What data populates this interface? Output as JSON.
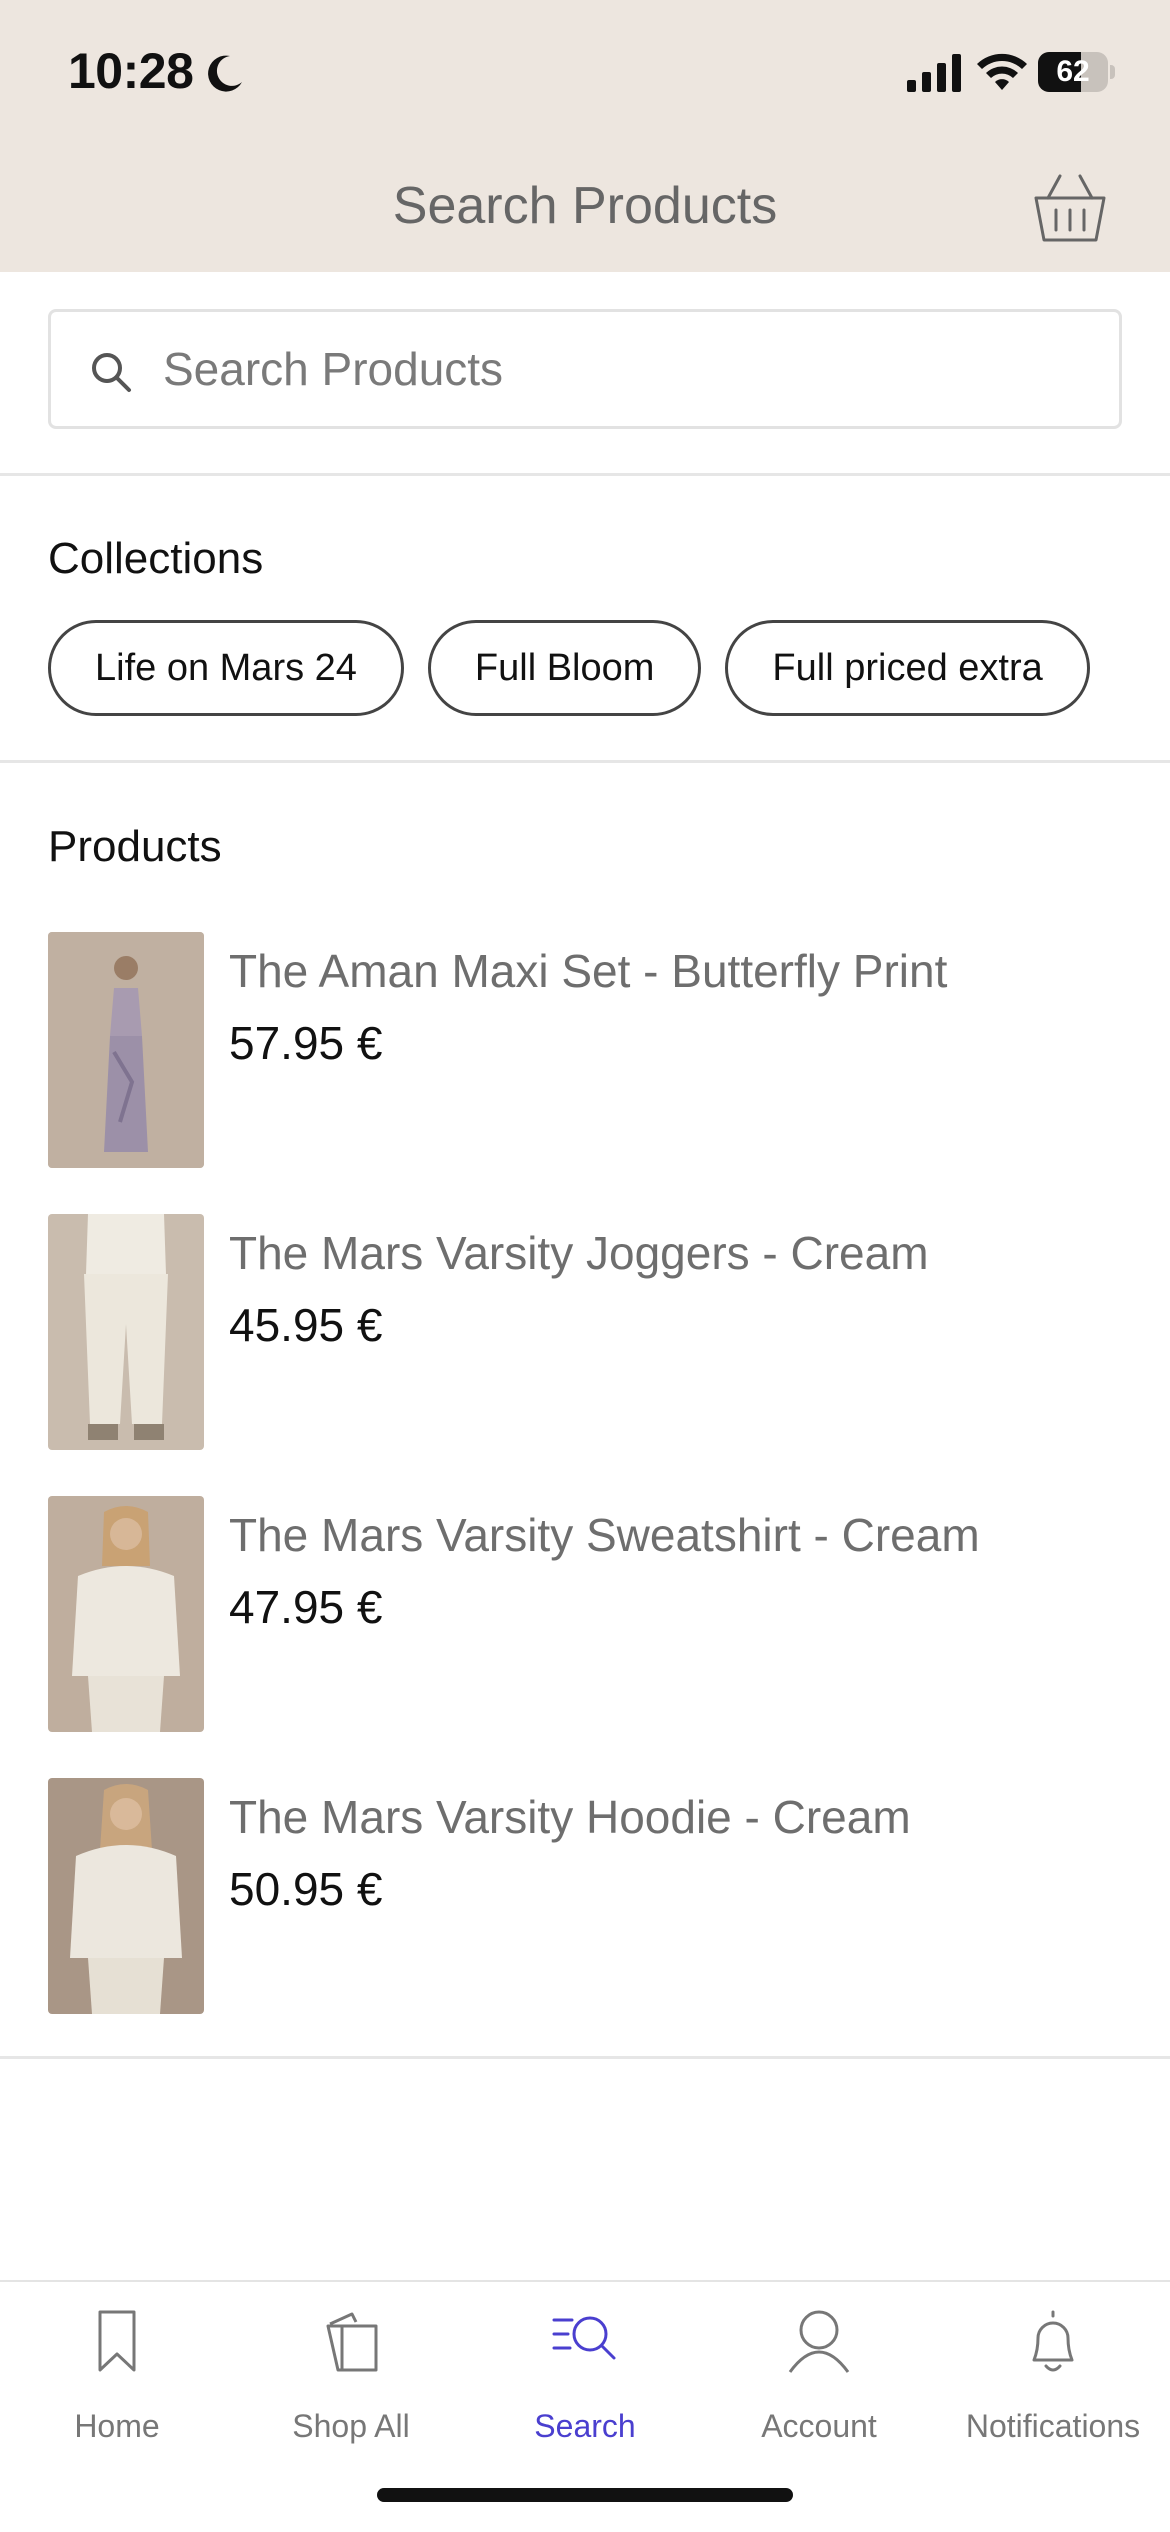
{
  "status_bar": {
    "time": "10:28",
    "battery": "62",
    "battery_level": 0.62
  },
  "header": {
    "title": "Search Products"
  },
  "search": {
    "placeholder": "Search Products",
    "value": ""
  },
  "collections": {
    "heading": "Collections",
    "items": [
      {
        "label": "Life on Mars 24"
      },
      {
        "label": "Full Bloom"
      },
      {
        "label": "Full priced extra"
      }
    ]
  },
  "products": {
    "heading": "Products",
    "items": [
      {
        "name": "The Aman Maxi Set - Butterfly Print",
        "price": "57.95 €"
      },
      {
        "name": "The Mars Varsity Joggers - Cream",
        "price": "45.95 €"
      },
      {
        "name": "The Mars Varsity Sweatshirt - Cream",
        "price": "47.95 €"
      },
      {
        "name": "The Mars Varsity Hoodie - Cream",
        "price": "50.95 €"
      }
    ]
  },
  "tab_bar": {
    "items": [
      {
        "label": "Home",
        "icon": "bookmark-icon"
      },
      {
        "label": "Shop All",
        "icon": "shopping-bag-icon"
      },
      {
        "label": "Search",
        "icon": "search-list-icon",
        "active": true
      },
      {
        "label": "Account",
        "icon": "person-icon"
      },
      {
        "label": "Notifications",
        "icon": "bell-icon"
      }
    ]
  },
  "colors": {
    "header_bg": "#ede6df",
    "active_tab": "#4a3fcf",
    "inactive_tab": "#777777"
  }
}
